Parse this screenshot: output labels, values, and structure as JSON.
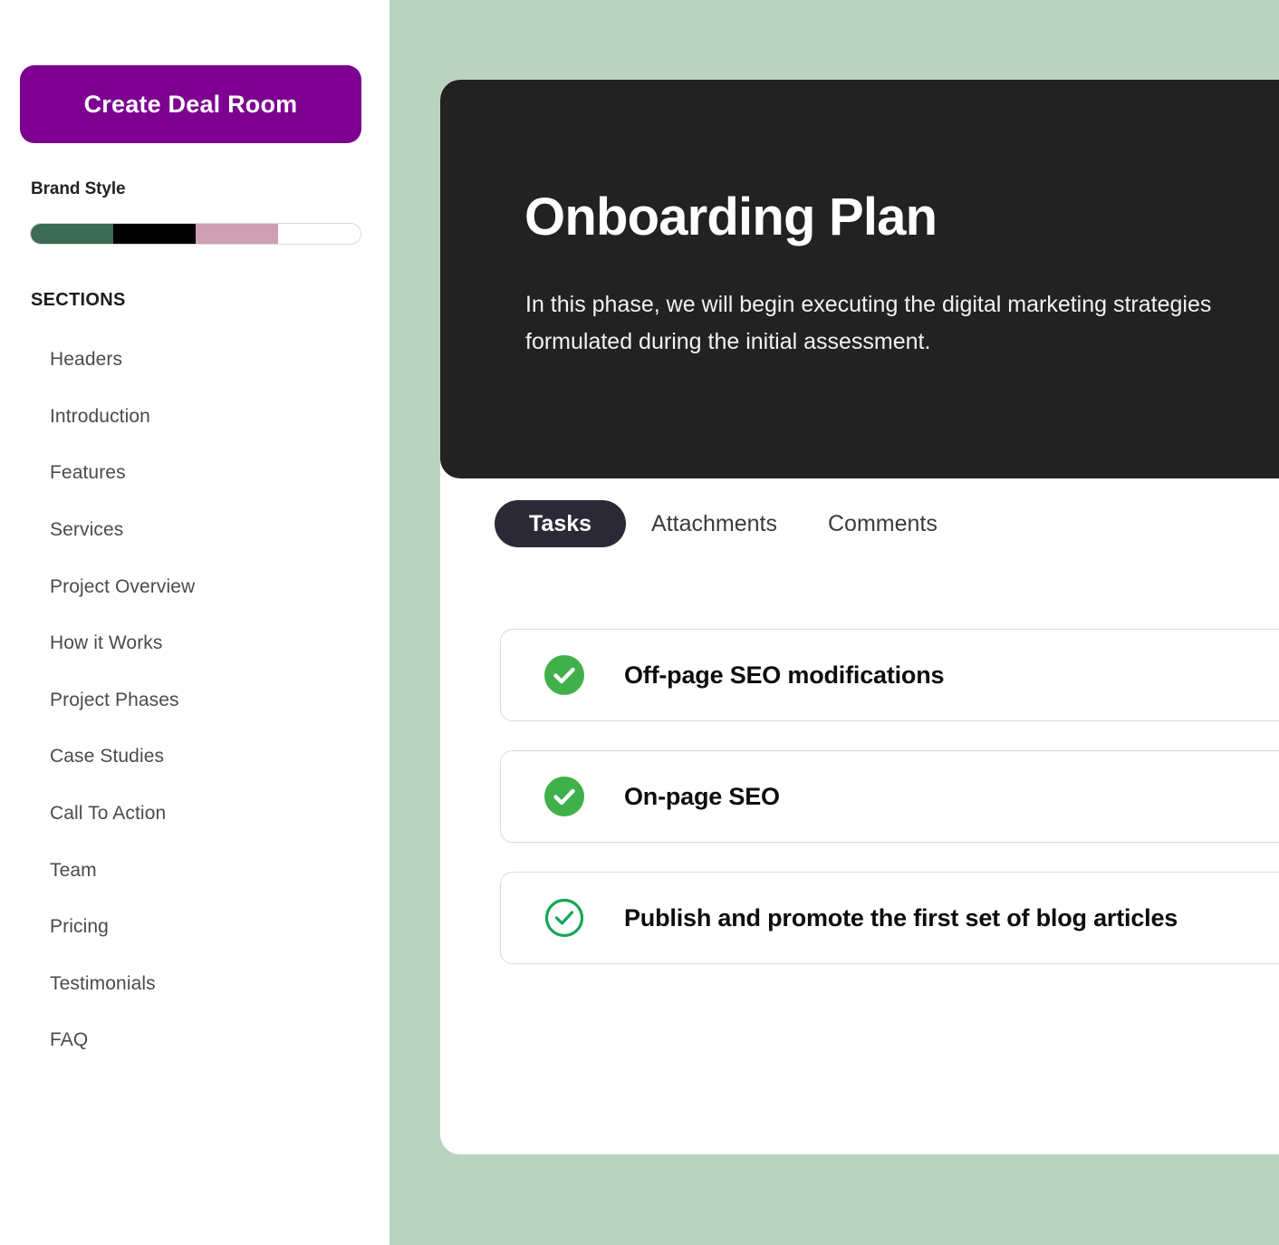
{
  "colors": {
    "page_background": "#bad3c1",
    "sidebar_background": "#ffffff",
    "primary_button": "#7d0091",
    "hero_background": "#222222",
    "active_tab": "#2c2937",
    "check_filled": "#40b04b",
    "check_outline": "#18a558"
  },
  "sidebar": {
    "create_button_label": "Create Deal Room",
    "brand_style_label": "Brand Style",
    "brand_swatches": [
      {
        "name": "brand-color-green",
        "hex": "#3d6b56"
      },
      {
        "name": "brand-color-black",
        "hex": "#000000"
      },
      {
        "name": "brand-color-pink",
        "hex": "#cda0b4"
      },
      {
        "name": "brand-color-white",
        "hex": "#ffffff"
      }
    ],
    "sections_title": "SECTIONS",
    "sections": [
      {
        "label": "Headers"
      },
      {
        "label": "Introduction"
      },
      {
        "label": "Features"
      },
      {
        "label": "Services"
      },
      {
        "label": "Project Overview"
      },
      {
        "label": "How it Works"
      },
      {
        "label": "Project Phases"
      },
      {
        "label": "Case Studies"
      },
      {
        "label": "Call To Action"
      },
      {
        "label": "Team"
      },
      {
        "label": "Pricing"
      },
      {
        "label": "Testimonials"
      },
      {
        "label": "FAQ"
      }
    ]
  },
  "main": {
    "hero": {
      "title": "Onboarding Plan",
      "description": "In this phase, we will begin executing the digital marketing strategies formulated during the initial assessment."
    },
    "tabs": [
      {
        "label": "Tasks",
        "active": true
      },
      {
        "label": "Attachments",
        "active": false
      },
      {
        "label": "Comments",
        "active": false
      }
    ],
    "tasks": [
      {
        "label": "Off-page SEO modifications",
        "icon": "check-circle-filled-icon",
        "state": "complete"
      },
      {
        "label": "On-page SEO",
        "icon": "check-circle-filled-icon",
        "state": "complete"
      },
      {
        "label": "Publish and promote the first set of blog articles",
        "icon": "check-circle-outline-icon",
        "state": "pending"
      }
    ]
  }
}
